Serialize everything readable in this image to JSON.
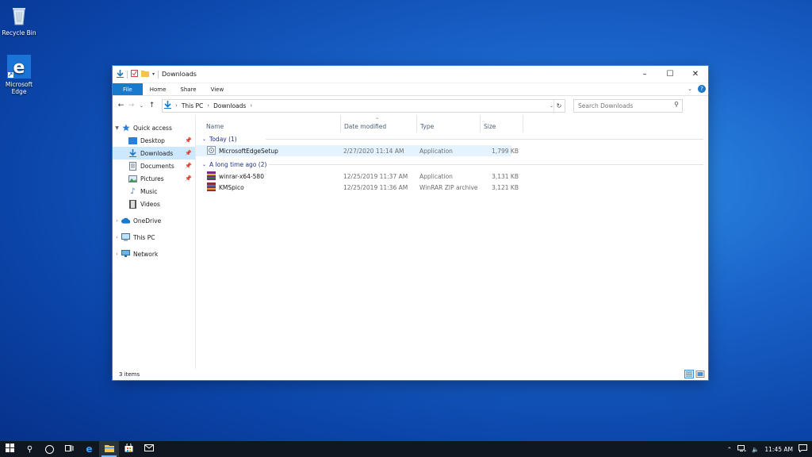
{
  "desktop": {
    "icons": [
      {
        "label": "Recycle Bin",
        "icon": "recycle-bin-icon"
      },
      {
        "label": "Microsoft Edge",
        "icon": "edge-icon"
      }
    ]
  },
  "window": {
    "title": "Downloads",
    "controls": {
      "minimize": "–",
      "maximize": "☐",
      "close": "✕"
    },
    "ribbon_tabs": [
      "File",
      "Home",
      "Share",
      "View"
    ],
    "address": {
      "segments": [
        "This PC",
        "Downloads"
      ]
    },
    "search": {
      "placeholder": "Search Downloads"
    },
    "nav": {
      "quick_access": "Quick access",
      "pinned": [
        "Desktop",
        "Downloads",
        "Documents",
        "Pictures"
      ],
      "unpinned": [
        "Music",
        "Videos"
      ],
      "onedrive": "OneDrive",
      "this_pc": "This PC",
      "network": "Network"
    },
    "columns": {
      "name": "Name",
      "date": "Date modified",
      "type": "Type",
      "size": "Size"
    },
    "groups": [
      {
        "label": "Today (1)",
        "files": [
          {
            "name": "MicrosoftEdgeSetup",
            "date": "2/27/2020 11:14 AM",
            "type": "Application",
            "size": "1,799 KB",
            "icon": "installer-icon"
          }
        ]
      },
      {
        "label": "A long time ago (2)",
        "files": [
          {
            "name": "winrar-x64-580",
            "date": "12/25/2019 11:37 AM",
            "type": "Application",
            "size": "3,131 KB",
            "icon": "winrar-icon"
          },
          {
            "name": "KMSpico",
            "date": "12/25/2019 11:36 AM",
            "type": "WinRAR ZIP archive",
            "size": "3,121 KB",
            "icon": "winrar-archive-icon"
          }
        ]
      }
    ],
    "status": "3 items"
  },
  "taskbar": {
    "clock": "11:45 AM"
  },
  "colors": {
    "accent": "#1979ca",
    "selection": "#cce8ff",
    "hover": "#e5f3ff",
    "group_text": "#1e3287"
  }
}
